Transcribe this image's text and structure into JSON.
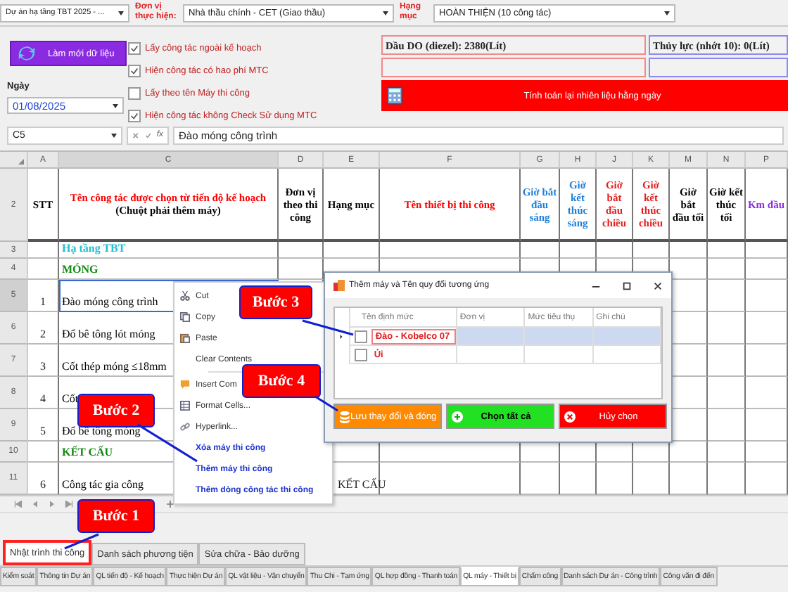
{
  "top_bar": {
    "project": "Dự án hạ tầng TBT 2025 - ...",
    "unit_label": "Đơn vị thực hiện:",
    "unit": "Nhà thầu chính - CET (Giao thầu)",
    "category_label": "Hạng mục",
    "category": "HOÀN THIỆN (10 công tác)"
  },
  "refresh_button": "Làm mới dữ liệu",
  "options": [
    {
      "label": "Lấy công tác ngoài kế hoạch",
      "checked": true
    },
    {
      "label": "Hiện công tác có hao phí MTC",
      "checked": true
    },
    {
      "label": "Lấy theo tên Máy thi công",
      "checked": false
    },
    {
      "label": "Hiện công tác không Check Sử dụng MTC",
      "checked": true
    }
  ],
  "date_label": "Ngày",
  "date": "01/08/2025",
  "fuel": [
    {
      "text": "Dầu DO (diezel): 2380(Lít)",
      "color": "#f08a8a"
    },
    {
      "text": "Thủy lực (nhớt 10): 0(Lít)",
      "color": "#8a8af0"
    }
  ],
  "calc_button": "Tính toán lại nhiên liệu hằng ngày",
  "formula_bar": {
    "cell": "C5",
    "fx": "fx",
    "value": "Đào móng công trình"
  },
  "sheet": {
    "columns": [
      {
        "letter": "A",
        "header": "STT",
        "color": "#000000"
      },
      {
        "letter": "C",
        "header": "Tên công tác được chọn từ tiến độ kế hoạch",
        "note": "(Chuột phải thêm máy)",
        "color": "#ff0000"
      },
      {
        "letter": "D",
        "header": "Đơn vị theo thi công",
        "color": "#000000"
      },
      {
        "letter": "E",
        "header": "Hạng mục",
        "color": "#000000"
      },
      {
        "letter": "F",
        "header": "Tên thiết bị thi công",
        "color": "#ff0000"
      },
      {
        "letter": "G",
        "header": "Giờ bắt đầu sáng",
        "color": "#1e7fd8"
      },
      {
        "letter": "H",
        "header": "Giờ kết thúc sáng",
        "color": "#1e7fd8"
      },
      {
        "letter": "J",
        "header": "Giờ bắt đầu chiều",
        "color": "#e02020"
      },
      {
        "letter": "K",
        "header": "Giờ kết thúc chiều",
        "color": "#e02020"
      },
      {
        "letter": "M",
        "header": "Giờ bắt đầu tối",
        "color": "#000000"
      },
      {
        "letter": "N",
        "header": "Giờ kết thúc tối",
        "color": "#000000"
      },
      {
        "letter": "P",
        "header": "Km đầu",
        "color": "#8a2be2"
      }
    ],
    "header_row_number": "2",
    "rows": [
      {
        "number": "3",
        "name": "Hạ tầng TBT",
        "kind": "project",
        "selected": false
      },
      {
        "number": "4",
        "name": "MÓNG",
        "kind": "section",
        "selected": false
      },
      {
        "number": "5",
        "stt": "1",
        "name": "Đào móng công trình",
        "kind": "task",
        "selected": true
      },
      {
        "number": "6",
        "stt": "2",
        "name": "Đổ bê tông lót móng",
        "kind": "task",
        "selected": false
      },
      {
        "number": "7",
        "stt": "3",
        "name": "Cốt thép móng ≤18mm",
        "kind": "task",
        "selected": false
      },
      {
        "number": "8",
        "stt": "4",
        "name": "Cốt",
        "kind": "task",
        "selected": false
      },
      {
        "number": "9",
        "stt": "5",
        "name": "Đổ bê tông móng",
        "kind": "task",
        "selected": false
      },
      {
        "number": "10",
        "name": "KẾT CẤU",
        "kind": "section",
        "selected": false
      },
      {
        "number": "11",
        "stt": "6",
        "name": "Công tác gia công",
        "category": "KẾT CẤU",
        "kind": "task",
        "selected": false
      }
    ]
  },
  "context_menu": [
    {
      "label": "Cut",
      "kind": "command"
    },
    {
      "label": "Copy",
      "kind": "command"
    },
    {
      "label": "Paste",
      "kind": "command"
    },
    {
      "label": "Clear Contents",
      "kind": "command"
    },
    {
      "label": "Insert Com",
      "kind": "command"
    },
    {
      "label": "Format Cells...",
      "kind": "command"
    },
    {
      "label": "Hyperlink...",
      "kind": "command"
    },
    {
      "label": "Xóa máy thi công",
      "kind": "custom"
    },
    {
      "label": "Thêm máy thi công",
      "kind": "custom"
    },
    {
      "label": "Thêm dòng công tác thi công",
      "kind": "custom"
    }
  ],
  "dialog": {
    "title": "Thêm máy và Tên quy đổi tương ứng",
    "columns": [
      "Tên định mức",
      "Đơn vị",
      "Mức tiêu thụ",
      "Ghi chú"
    ],
    "rows": [
      {
        "name": "Đào - Kobelco 07",
        "checked": false,
        "selected": true
      },
      {
        "name": "Ủi",
        "checked": false,
        "selected": false
      }
    ],
    "buttons": [
      {
        "label": "Lưu thay đổi và đóng",
        "kind": "save"
      },
      {
        "label": "Chọn tất cả",
        "kind": "add"
      },
      {
        "label": "Hủy chọn",
        "kind": "cancel"
      }
    ]
  },
  "callouts": [
    "Bước 3",
    "Bước 4",
    "Bước 2",
    "Bước 1"
  ],
  "sheet_tabs": [
    {
      "label": "Nhật trình thi công",
      "selected": true
    },
    {
      "label": "Danh sách phương tiện",
      "selected": false
    },
    {
      "label": "Sửa chữa - Bảo dưỡng",
      "selected": false
    }
  ],
  "module_tabs": [
    {
      "label": "Kiểm soát",
      "selected": false
    },
    {
      "label": "Thông tin Dự án",
      "selected": false
    },
    {
      "label": "QL tiến độ - Kế hoạch",
      "selected": false
    },
    {
      "label": "Thực hiện Dự án",
      "selected": false
    },
    {
      "label": "QL vật liệu - Vận chuyển",
      "selected": false
    },
    {
      "label": "Thu Chi - Tạm ứng",
      "selected": false
    },
    {
      "label": "QL hợp đồng - Thanh toán",
      "selected": false
    },
    {
      "label": "QL máy - Thiết bị",
      "selected": true
    },
    {
      "label": "Chấm công",
      "selected": false
    },
    {
      "label": "Danh sách Dự án - Công trình",
      "selected": false
    },
    {
      "label": "Công văn đi đến",
      "selected": false
    }
  ]
}
